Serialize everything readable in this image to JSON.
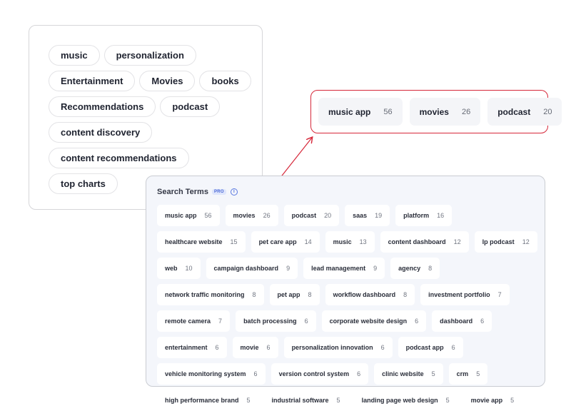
{
  "tags": [
    "music",
    "personalization",
    "Entertainment",
    "Movies",
    "books",
    "Recommendations",
    "podcast",
    "content discovery",
    "content recommendations",
    "top charts"
  ],
  "highlight": [
    {
      "label": "music app",
      "count": "56"
    },
    {
      "label": "movies",
      "count": "26"
    },
    {
      "label": "podcast",
      "count": "20"
    }
  ],
  "search_terms": {
    "title": "Search Terms",
    "badge": "PRO",
    "info_glyph": "i",
    "items": [
      {
        "label": "music app",
        "count": "56"
      },
      {
        "label": "movies",
        "count": "26"
      },
      {
        "label": "podcast",
        "count": "20"
      },
      {
        "label": "saas",
        "count": "19"
      },
      {
        "label": "platform",
        "count": "16"
      },
      {
        "label": "healthcare website",
        "count": "15"
      },
      {
        "label": "pet care app",
        "count": "14"
      },
      {
        "label": "music",
        "count": "13"
      },
      {
        "label": "content dashboard",
        "count": "12"
      },
      {
        "label": "lp podcast",
        "count": "12"
      },
      {
        "label": "web",
        "count": "10"
      },
      {
        "label": "campaign dashboard",
        "count": "9"
      },
      {
        "label": "lead management",
        "count": "9"
      },
      {
        "label": "agency",
        "count": "8"
      },
      {
        "label": "network traffic monitoring",
        "count": "8"
      },
      {
        "label": "pet app",
        "count": "8"
      },
      {
        "label": "workflow dashboard",
        "count": "8"
      },
      {
        "label": "investment portfolio",
        "count": "7"
      },
      {
        "label": "remote camera",
        "count": "7"
      },
      {
        "label": "batch processing",
        "count": "6"
      },
      {
        "label": "corporate website design",
        "count": "6"
      },
      {
        "label": "dashboard",
        "count": "6"
      },
      {
        "label": "entertainment",
        "count": "6"
      },
      {
        "label": "movie",
        "count": "6"
      },
      {
        "label": "personalization innovation",
        "count": "6"
      },
      {
        "label": "podcast app",
        "count": "6"
      },
      {
        "label": "vehicle monitoring system",
        "count": "6"
      },
      {
        "label": "version control system",
        "count": "6"
      },
      {
        "label": "clinic website",
        "count": "5"
      },
      {
        "label": "crm",
        "count": "5"
      },
      {
        "label": "high performance brand",
        "count": "5"
      },
      {
        "label": "industrial software",
        "count": "5"
      },
      {
        "label": "landing page web design",
        "count": "5"
      },
      {
        "label": "movie app",
        "count": "5"
      }
    ]
  },
  "colors": {
    "highlight_border": "#d6283a",
    "arrow": "#d6283a",
    "panel_bg": "#f4f6fb",
    "pro_badge": "#4866d6"
  },
  "icons": {
    "info": "info-icon",
    "arrow": "arrow-up-right-icon"
  }
}
